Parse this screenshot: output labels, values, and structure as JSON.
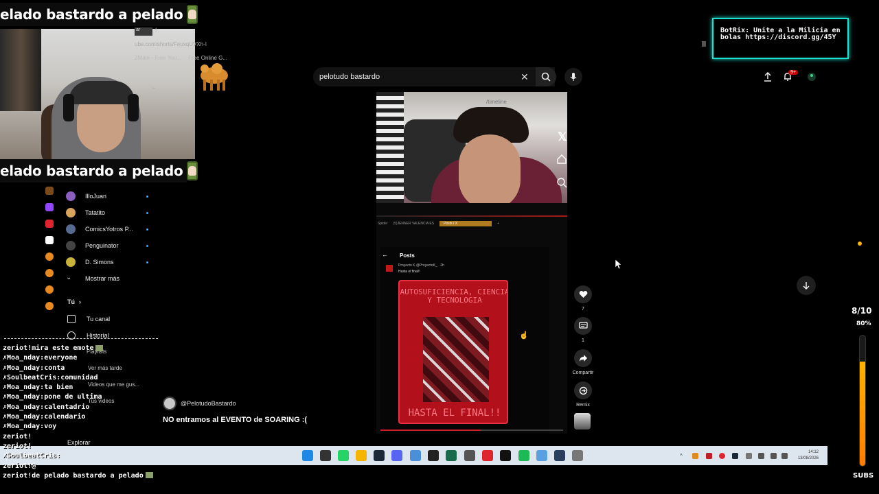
{
  "overlay": {
    "banner_text": "elado bastardo a pelado",
    "botrix_text": "BotRix: Unite a la Milicia en bolas https://discord.gg/45Y",
    "goal": {
      "label": "8/10",
      "percent_label": "80%",
      "progress": 0.8,
      "units": "SUBS"
    },
    "accent_color": "#19e3d2"
  },
  "browser": {
    "url": "ube.com/shorts/FeuxqUVXh-I",
    "bookmarks": [
      "2Mate - Free You...",
      "Free Online G..."
    ]
  },
  "youtube": {
    "search_value": "pelotudo bastardo",
    "notification_badge": "9+",
    "sidebar": {
      "subscriptions": [
        {
          "name": "IlloJuan",
          "color": "#8b5fbf"
        },
        {
          "name": "Tatatito",
          "color": "#d8a35a"
        },
        {
          "name": "ComicsYotros P...",
          "color": "#556b8f"
        },
        {
          "name": "Penguinator",
          "color": "#333"
        },
        {
          "name": "D. Simons",
          "color": "#c7b23a"
        }
      ],
      "show_more": "Mostrar más",
      "you_section": "Tú",
      "you_items": [
        "Tu canal",
        "Historial",
        "Playlists",
        "Ver más tarde",
        "Videos que me gus...",
        "Tus videos"
      ],
      "explore": "Explorar"
    },
    "short": {
      "channel": "@PelotudoBastardo",
      "title": "NO entramos al EVENTO de SOARING :(",
      "likes": "7",
      "comments": "1",
      "share_label": "Compartir",
      "remix_label": "Remix",
      "progress": 0.55,
      "phone_url": "/timeline",
      "embedded_tab": "Posts / X",
      "embedded_tab2": "(5)JENNER VALENCIA ES",
      "embedded_tab0": "Spider",
      "posts_header": "Posts",
      "tweet_author": "Proyecto K @ProyectoK_ · 2h",
      "tweet_text": "Hasta el final!!",
      "poster_top": "AUTOSUFICIENCIA, CIENCIA Y TECNOLOGIA",
      "poster_bottom": "HASTA EL FINAL!!"
    }
  },
  "chat": [
    {
      "user": "zeriot!",
      "msg": "mira este emote",
      "emote": true
    },
    {
      "user": "✗Moa_nday:",
      "msg": "everyone"
    },
    {
      "user": "✗Moa_nday:",
      "msg": "conta"
    },
    {
      "user": "✗SoulbeatCris:",
      "msg": "comunidad"
    },
    {
      "user": "✗Moa_nday:",
      "msg": "ta bien"
    },
    {
      "user": "✗Moa_nday:",
      "msg": "pone de ultima"
    },
    {
      "user": "✗Moa_nday:",
      "msg": "calentadrio"
    },
    {
      "user": "✗Moa_nday:",
      "msg": "calendario"
    },
    {
      "user": "✗Moa_nday:",
      "msg": "voy"
    },
    {
      "user": "zeriot!",
      "msg": ""
    },
    {
      "user": "zeriot!",
      "msg": ""
    },
    {
      "user": "✗SoulbeatCris:",
      "msg": ""
    },
    {
      "user": "zeriot!",
      "msg": "@"
    },
    {
      "user": "zeriot!",
      "msg": "de pelado bastardo a pelado",
      "emote": true
    }
  ],
  "taskbar": {
    "time": "14:12",
    "date": "13/08/2026",
    "apps": [
      {
        "name": "windows-start-icon",
        "color": "#1e88e5"
      },
      {
        "name": "search-icon",
        "color": "#333"
      },
      {
        "name": "whatsapp-icon",
        "color": "#25d366"
      },
      {
        "name": "file-explorer-icon",
        "color": "#f4b400"
      },
      {
        "name": "steam-icon",
        "color": "#1b2838"
      },
      {
        "name": "discord-icon",
        "color": "#5865f2"
      },
      {
        "name": "app-icon-blue",
        "color": "#4a8fd8"
      },
      {
        "name": "obs-icon",
        "color": "#222"
      },
      {
        "name": "app-icon-green",
        "color": "#1a6b4a"
      },
      {
        "name": "chrome-icon",
        "color": "#555"
      },
      {
        "name": "opera-icon",
        "color": "#e0242f"
      },
      {
        "name": "app-icon-circle",
        "color": "#111"
      },
      {
        "name": "spotify-icon",
        "color": "#1db954"
      },
      {
        "name": "app-icon-diamond",
        "color": "#5aa0e0"
      },
      {
        "name": "steam-icon-2",
        "color": "#2a3f5f"
      },
      {
        "name": "app-icon-gray",
        "color": "#777"
      }
    ]
  }
}
